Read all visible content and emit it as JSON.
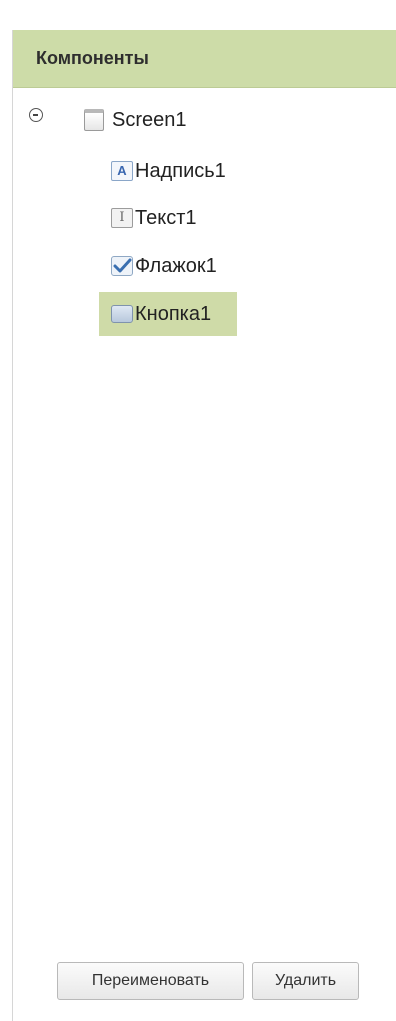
{
  "panel": {
    "title": "Компоненты"
  },
  "tree": {
    "root": {
      "label": "Screen1",
      "expanded": true
    },
    "children": [
      {
        "label": "Надпись1",
        "icon": "label-icon",
        "selected": false
      },
      {
        "label": "Текст1",
        "icon": "textbox-icon",
        "selected": false
      },
      {
        "label": "Флажок1",
        "icon": "checkbox-icon",
        "selected": false
      },
      {
        "label": "Кнопка1",
        "icon": "button-icon",
        "selected": true
      }
    ]
  },
  "actions": {
    "rename_label": "Переименовать",
    "delete_label": "Удалить"
  },
  "colors": {
    "header_bg": "#cddca8",
    "selection_bg": "#cfdba8"
  }
}
